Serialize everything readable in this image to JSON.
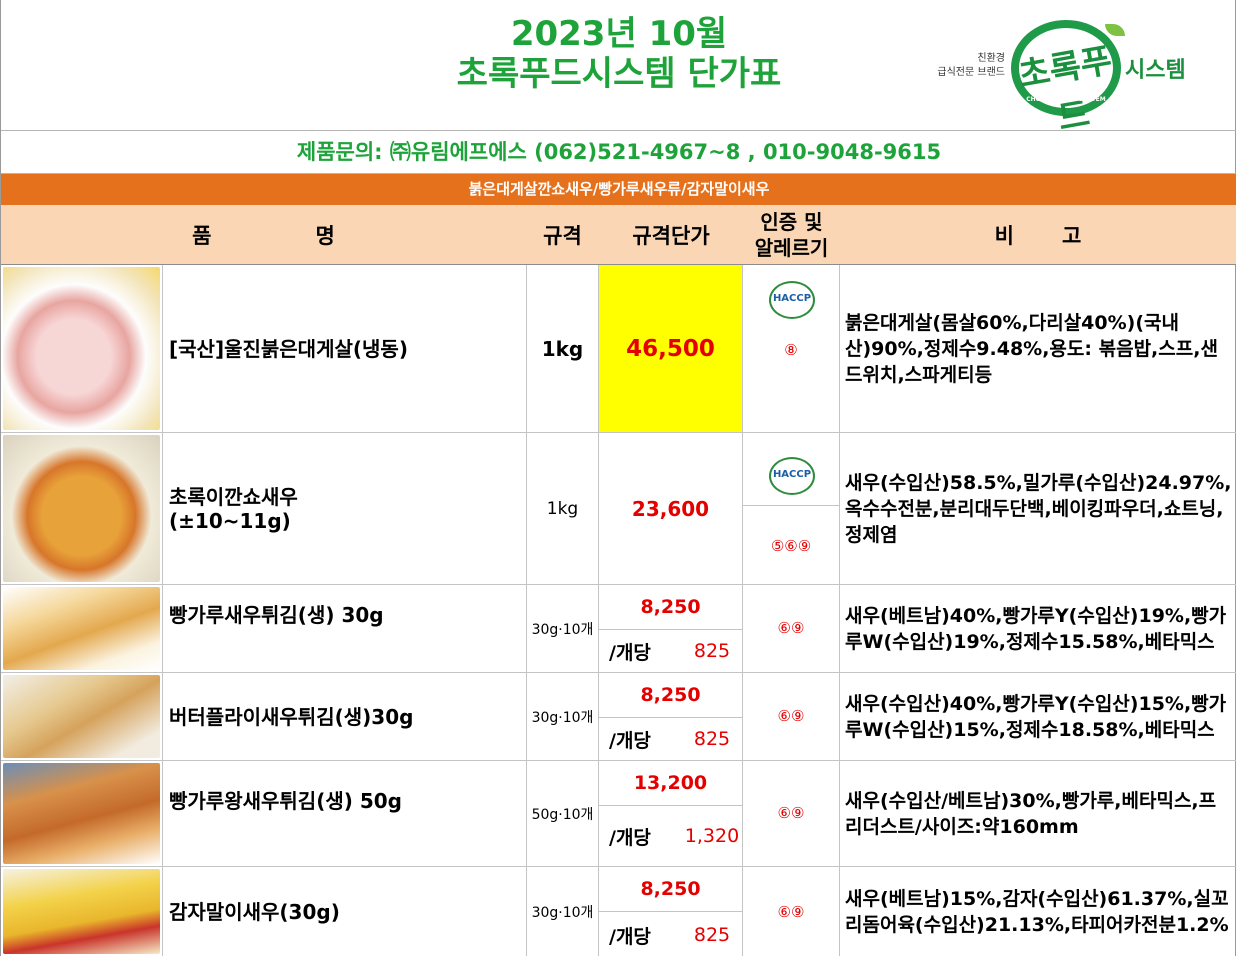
{
  "header": {
    "title_line1": "2023년 10월",
    "title_line2": "초록푸드시스템 단가표",
    "logo_caption_line1": "친환경",
    "logo_caption_line2": "급식전문 브랜드",
    "logo_mark": "초록푸드",
    "logo_ring_text": "CHOROK FOOD SYSTEM",
    "logo_text": "시스템",
    "contact": "제품문의: ㈜유림에프에스 (062)521-4967~8 , 010-9048-9615",
    "category": "붉은대게살깐쇼새우/빵가루새우류/감자말이새우"
  },
  "columns": {
    "name_a": "품",
    "name_b": "명",
    "spec": "규격",
    "price": "규격단가",
    "cert_line1": "인증 및",
    "cert_line2": "알레르기",
    "note_a": "비",
    "note_b": "고"
  },
  "per_label": "/개당",
  "haccp_label": "HACCP",
  "products": [
    {
      "name_line1": "[국산]울진붉은대게살(냉동)",
      "name_line2": "",
      "spec": "1kg",
      "price": "46,500",
      "unit_price": "",
      "haccp": true,
      "allergen": "⑧",
      "note": "붉은대게살(몸살60%,다리살40%)(국내산)90%,정제수9.48%,용도: 볶음밥,스프,샌드위치,스파게티등"
    },
    {
      "name_line1": "초록이깐쇼새우",
      "name_line2": "(±10~11g)",
      "spec": "1kg",
      "price": "23,600",
      "unit_price": "",
      "haccp": true,
      "allergen": "⑤⑥⑨",
      "note": "새우(수입산)58.5%,밀가루(수입산)24.97%,옥수수전분,분리대두단백,베이킹파우더,쇼트닝,정제염"
    },
    {
      "name_line1": "빵가루새우튀김(생) 30g",
      "name_line2": "",
      "spec": "30g·10개",
      "price": "8,250",
      "unit_price": "825",
      "haccp": false,
      "allergen": "⑥⑨",
      "note": "새우(베트남)40%,빵가루Y(수입산)19%,빵가루W(수입산)19%,정제수15.58%,베타믹스"
    },
    {
      "name_line1": "버터플라이새우튀김(생)30g",
      "name_line2": "",
      "spec": "30g·10개",
      "price": "8,250",
      "unit_price": "825",
      "haccp": false,
      "allergen": "⑥⑨",
      "note": "새우(수입산)40%,빵가루Y(수입산)15%,빵가루W(수입산)15%,정제수18.58%,베타믹스"
    },
    {
      "name_line1": "빵가루왕새우튀김(생) 50g",
      "name_line2": "",
      "spec": "50g·10개",
      "price": "13,200",
      "unit_price": "1,320",
      "haccp": false,
      "allergen": "⑥⑨",
      "note": "새우(수입산/베트남)30%,빵가루,베타믹스,프리더스트/사이즈:약160mm"
    },
    {
      "name_line1": "감자말이새우(30g)",
      "name_line2": "",
      "spec": "30g·10개",
      "price": "8,250",
      "unit_price": "825",
      "haccp": false,
      "allergen": "⑥⑨",
      "note": "새우(베트남)15%,감자(수입산)61.37%,실꼬리돔어육(수입산)21.13%,타피어카전분1.2%"
    }
  ]
}
